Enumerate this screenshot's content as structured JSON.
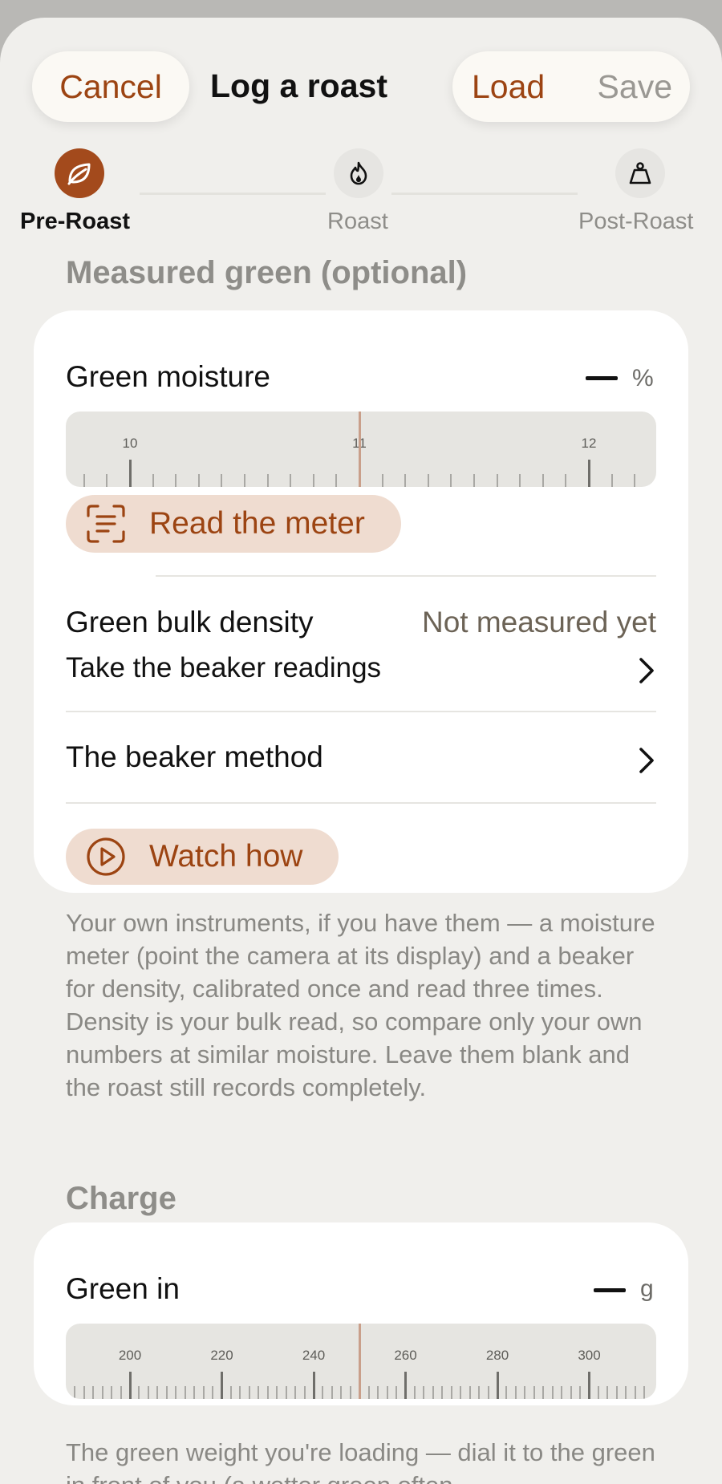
{
  "header": {
    "cancel_label": "Cancel",
    "title": "Log a roast",
    "load_label": "Load",
    "save_label": "Save"
  },
  "steps": [
    {
      "label": "Pre-Roast",
      "icon": "leaf-icon",
      "state": "active"
    },
    {
      "label": "Roast",
      "icon": "flame-icon",
      "state": "inactive"
    },
    {
      "label": "Post-Roast",
      "icon": "scale-icon",
      "state": "inactive"
    }
  ],
  "measured_green": {
    "section_title": "Measured green (optional)",
    "moisture": {
      "label": "Green moisture",
      "value": "",
      "unit": "%",
      "ruler_labels": [
        "10",
        "11",
        "12"
      ],
      "selected": 11
    },
    "read_meter_label": "Read the meter",
    "bulk_density": {
      "label": "Green bulk density",
      "value": "Not measured yet",
      "action": "Take the beaker readings"
    },
    "beaker_method_label": "The beaker method",
    "watch_how_label": "Watch how",
    "footer": "Your own instruments, if you have them — a moisture meter (point the camera at its display) and a beaker for density, calibrated once and read three times. Density is your bulk read, so compare only your own numbers at similar moisture. Leave them blank and the roast still records completely."
  },
  "charge": {
    "section_title": "Charge",
    "green_in": {
      "label": "Green in",
      "value": "",
      "unit": "g",
      "ruler_labels": [
        "200",
        "220",
        "240",
        "260",
        "280",
        "300"
      ],
      "selected": 250
    },
    "footer": "The green weight you're loading — dial it to the green in front of you (a wetter green often"
  },
  "colors": {
    "accent": "#a34a1c",
    "accent_text": "#9c4412",
    "chip_bg": "#efdcd0",
    "background": "#f0efec"
  }
}
